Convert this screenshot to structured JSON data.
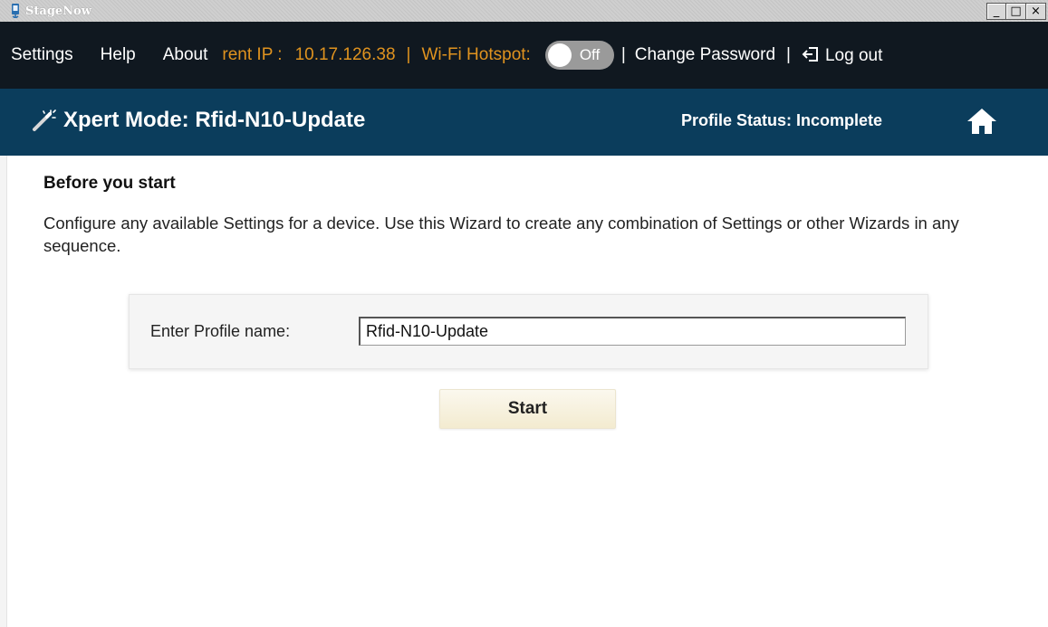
{
  "window": {
    "title": "StageNow",
    "controls": {
      "minimize": "_",
      "maximize": "□",
      "close": "×"
    }
  },
  "menubar": {
    "items": [
      "Settings",
      "Help",
      "About"
    ],
    "ip_label": "rent IP :",
    "ip_value": "10.17.126.38",
    "separator": "|",
    "hotspot_label": "Wi-Fi Hotspot:",
    "hotspot_state": "Off",
    "change_password": "Change Password",
    "logout": "Log out",
    "accent_color": "#e0931f"
  },
  "header": {
    "mode_title": "Xpert Mode: Rfid-N10-Update",
    "profile_status": "Profile Status: Incomplete",
    "background": "#0b3d5c",
    "icons": [
      "wand-icon",
      "home-icon"
    ]
  },
  "content": {
    "section_title": "Before you start",
    "description": "Configure any available Settings for a device. Use this Wizard to create any combination of Settings or other Wizards in any sequence.",
    "profile_label": "Enter Profile name:",
    "profile_value": "Rfid-N10-Update",
    "start_label": "Start"
  }
}
